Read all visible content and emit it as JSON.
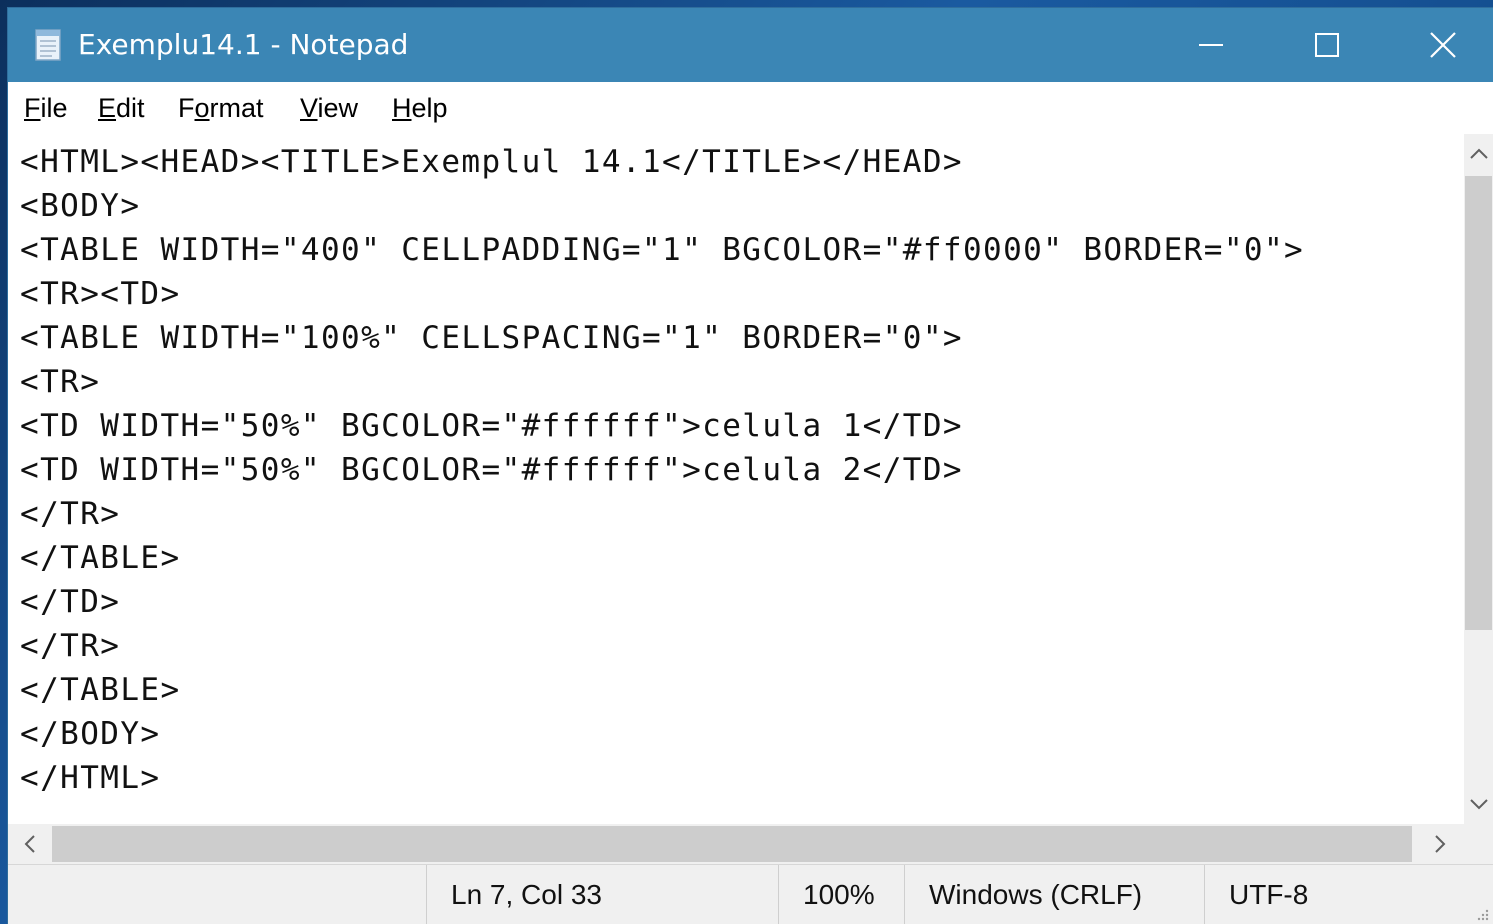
{
  "window": {
    "title": "Exemplu14.1 - Notepad",
    "titlebar_color": "#3b86b5",
    "icon": "notepad-icon"
  },
  "controls": {
    "minimize_icon": "minimize-icon",
    "maximize_icon": "maximize-icon",
    "close_icon": "close-icon"
  },
  "menu": {
    "items": [
      {
        "label": "File",
        "mnemonic": "F"
      },
      {
        "label": "Edit",
        "mnemonic": "E"
      },
      {
        "label": "Format",
        "mnemonic": "o"
      },
      {
        "label": "View",
        "mnemonic": "V"
      },
      {
        "label": "Help",
        "mnemonic": "H"
      }
    ]
  },
  "editor": {
    "lines": [
      "<HTML><HEAD><TITLE>Exemplul 14.1</TITLE></HEAD>",
      "<BODY>",
      "<TABLE WIDTH=\"400\" CELLPADDING=\"1\" BGCOLOR=\"#ff0000\" BORDER=\"0\">",
      "<TR><TD>",
      "<TABLE WIDTH=\"100%\" CELLSPACING=\"1\" BORDER=\"0\">",
      "<TR>",
      "<TD WIDTH=\"50%\" BGCOLOR=\"#ffffff\">celula 1</TD>",
      "<TD WIDTH=\"50%\" BGCOLOR=\"#ffffff\">celula 2</TD>",
      "</TR>",
      "</TABLE>",
      "</TD>",
      "</TR>",
      "</TABLE>",
      "</BODY>",
      "</HTML>"
    ]
  },
  "statusbar": {
    "position": "Ln 7, Col 33",
    "zoom": "100%",
    "line_endings": "Windows (CRLF)",
    "encoding": "UTF-8"
  }
}
